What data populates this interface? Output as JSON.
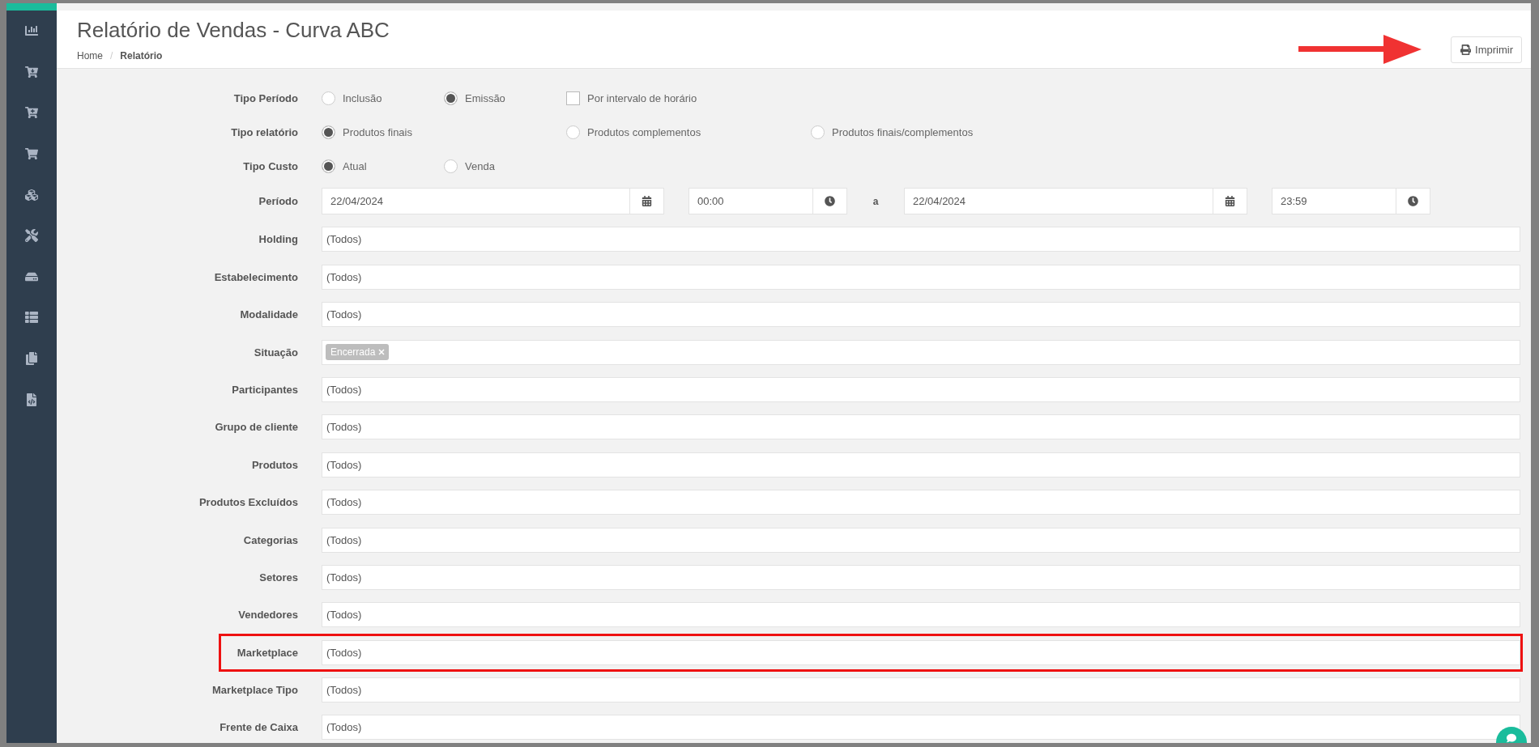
{
  "page": {
    "title": "Relatório de Vendas - Curva ABC",
    "print_button": "Imprimir"
  },
  "breadcrumb": {
    "separator": "/",
    "items": [
      {
        "label": "Home",
        "current": false
      },
      {
        "label": "Relatório",
        "current": true
      }
    ]
  },
  "option_groups": [
    {
      "label": "Tipo Período",
      "options": [
        {
          "kind": "radio",
          "label": "Inclusão",
          "selected": false
        },
        {
          "kind": "radio",
          "label": "Emissão",
          "selected": true
        },
        {
          "kind": "checkbox",
          "label": "Por intervalo de horário",
          "checked": false
        }
      ]
    },
    {
      "label": "Tipo relatório",
      "options": [
        {
          "kind": "radio",
          "label": "Produtos finais",
          "selected": true
        },
        {
          "kind": "radio",
          "label": "Produtos complementos",
          "selected": false
        },
        {
          "kind": "radio",
          "label": "Produtos finais/complementos",
          "selected": false
        }
      ]
    },
    {
      "label": "Tipo Custo",
      "options": [
        {
          "kind": "radio",
          "label": "Atual",
          "selected": true
        },
        {
          "kind": "radio",
          "label": "Venda",
          "selected": false
        }
      ]
    }
  ],
  "period": {
    "label": "Período",
    "start_date": "22/04/2024",
    "start_time": "00:00",
    "separator": "a",
    "end_date": "22/04/2024",
    "end_time": "23:59"
  },
  "filters": [
    {
      "label": "Holding",
      "value": "(Todos)",
      "highlighted": false
    },
    {
      "label": "Estabelecimento",
      "value": "(Todos)",
      "highlighted": false
    },
    {
      "label": "Modalidade",
      "value": "(Todos)",
      "highlighted": false
    },
    {
      "label": "Situação",
      "tags": [
        "Encerrada"
      ],
      "highlighted": false
    },
    {
      "label": "Participantes",
      "value": "(Todos)",
      "highlighted": false
    },
    {
      "label": "Grupo de cliente",
      "value": "(Todos)",
      "highlighted": false
    },
    {
      "label": "Produtos",
      "value": "(Todos)",
      "highlighted": false
    },
    {
      "label": "Produtos Excluídos",
      "value": "(Todos)",
      "highlighted": false
    },
    {
      "label": "Categorias",
      "value": "(Todos)",
      "highlighted": false
    },
    {
      "label": "Setores",
      "value": "(Todos)",
      "highlighted": false
    },
    {
      "label": "Vendedores",
      "value": "(Todos)",
      "highlighted": false
    },
    {
      "label": "Marketplace",
      "value": "(Todos)",
      "highlighted": true
    },
    {
      "label": "Marketplace Tipo",
      "value": "(Todos)",
      "highlighted": false
    },
    {
      "label": "Frente de Caixa",
      "value": "(Todos)",
      "highlighted": false
    }
  ]
}
